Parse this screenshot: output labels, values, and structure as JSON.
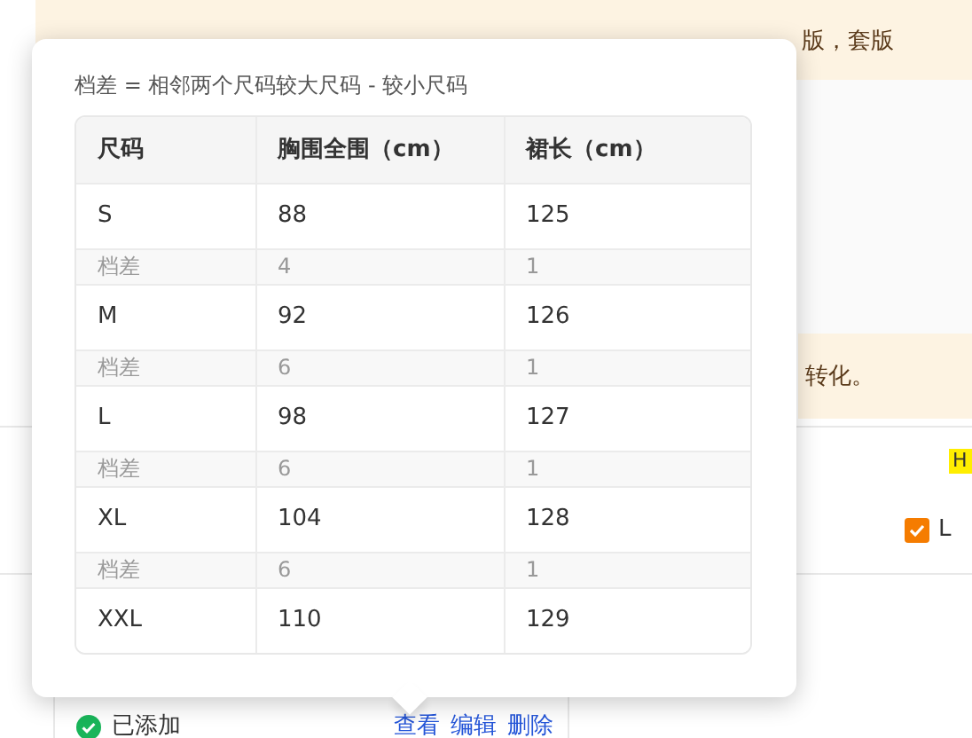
{
  "notice_top": {
    "text": "版，套版"
  },
  "notice_second": {
    "text": "转化。"
  },
  "tag": {
    "text": "H"
  },
  "size_option": {
    "label": "L",
    "checked": true
  },
  "status": {
    "text": "已添加",
    "done": true
  },
  "actions": [
    "查看",
    "编辑",
    "删除"
  ],
  "popover": {
    "caption": "档差 = 相邻两个尺码较大尺码 - 较小尺码",
    "columns": [
      "尺码",
      "胸围全围（cm）",
      "裙长（cm）"
    ],
    "rows": [
      {
        "kind": "size",
        "cells": [
          "S",
          "88",
          "125"
        ]
      },
      {
        "kind": "diff",
        "cells": [
          "档差",
          "4",
          "1"
        ]
      },
      {
        "kind": "size",
        "cells": [
          "M",
          "92",
          "126"
        ]
      },
      {
        "kind": "diff",
        "cells": [
          "档差",
          "6",
          "1"
        ]
      },
      {
        "kind": "size",
        "cells": [
          "L",
          "98",
          "127"
        ]
      },
      {
        "kind": "diff",
        "cells": [
          "档差",
          "6",
          "1"
        ]
      },
      {
        "kind": "size",
        "cells": [
          "XL",
          "104",
          "128"
        ]
      },
      {
        "kind": "diff",
        "cells": [
          "档差",
          "6",
          "1"
        ]
      },
      {
        "kind": "size",
        "cells": [
          "XXL",
          "110",
          "129"
        ]
      }
    ]
  }
}
